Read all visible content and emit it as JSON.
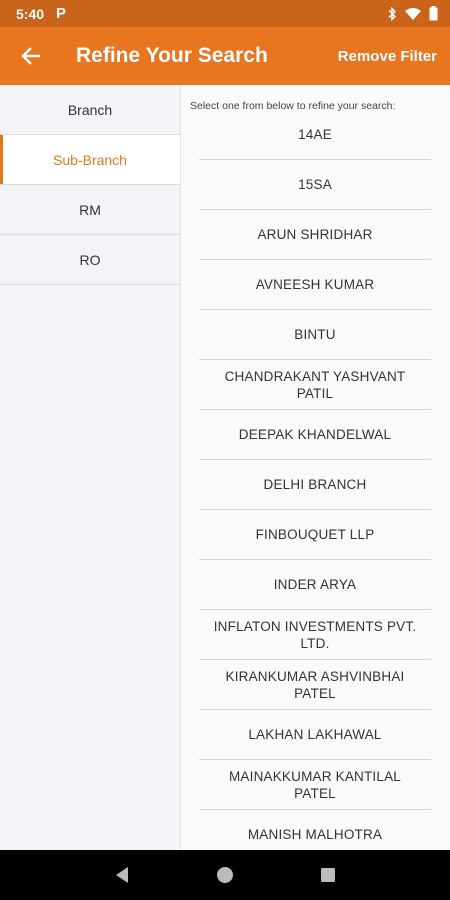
{
  "status_bar": {
    "time": "5:40",
    "notification_icon": "P"
  },
  "app_bar": {
    "title": "Refine Your Search",
    "action_label": "Remove Filter"
  },
  "sidebar": {
    "items": [
      {
        "label": "Branch",
        "active": false
      },
      {
        "label": "Sub-Branch",
        "active": true
      },
      {
        "label": "RM",
        "active": false
      },
      {
        "label": "RO",
        "active": false
      }
    ]
  },
  "content": {
    "hint": "Select one from below to refine your search:",
    "items": [
      "14AE",
      "15SA",
      "ARUN SHRIDHAR",
      "AVNEESH KUMAR",
      "BINTU",
      "CHANDRAKANT YASHVANT PATIL",
      "DEEPAK KHANDELWAL",
      "DELHI BRANCH",
      "FINBOUQUET LLP",
      "INDER ARYA",
      "INFLATON INVESTMENTS PVT. LTD.",
      "KIRANKUMAR ASHVINBHAI PATEL",
      "LAKHAN LAKHAWAL",
      "MAINAKKUMAR KANTILAL PATEL",
      "MANISH MALHOTRA"
    ]
  },
  "colors": {
    "accent": "#e8751f",
    "status_bar": "#c9641a",
    "sidebar_bg": "#f2f4f7"
  }
}
